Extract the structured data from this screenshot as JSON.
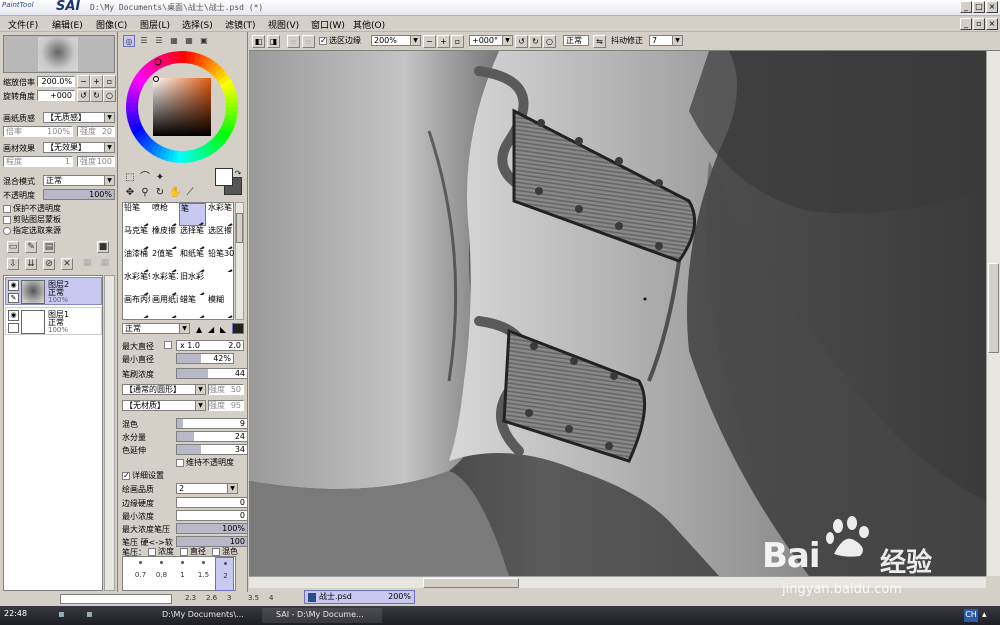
{
  "app": {
    "logo_small": "PaintTool",
    "logo_big": "SAI",
    "title": "D:\\My Documents\\桌面\\战士\\战士.psd (*)"
  },
  "menu": [
    "文件(F)",
    "编辑(E)",
    "图像(C)",
    "图层(L)",
    "选择(S)",
    "滤镜(T)",
    "视图(V)",
    "窗口(W)",
    "其他(O)"
  ],
  "navigator": {
    "zoom_label": "缩放倍率",
    "zoom_value": "200.0%",
    "rotate_label": "旋转角度",
    "rotate_value": "+000"
  },
  "layer_props": {
    "paper_label": "画纸质感",
    "paper_value": "【无质感】",
    "ratio_label": "倍率",
    "ratio_value": "100%",
    "strength_label": "强度",
    "strength_value": "20",
    "effect_label": "画材效果",
    "effect_value": "【无效果】",
    "degree_label": "程度",
    "degree_value": "1",
    "effect_strength_value": "100",
    "blend_label": "混合模式",
    "blend_value": "正常",
    "opacity_label": "不透明度",
    "opacity_value": "100%",
    "opacity_fraction": 1.0,
    "protect_opacity": "保护不透明度",
    "clip_group": "剪贴图层蒙板",
    "select_source": "指定选取来源"
  },
  "layers": [
    {
      "name": "图层2",
      "mode": "正常",
      "opacity": "100%",
      "selected": true
    },
    {
      "name": "图层1",
      "mode": "正常",
      "opacity": "100%",
      "selected": false
    }
  ],
  "brushes": [
    {
      "label": "铅笔"
    },
    {
      "label": "喷枪"
    },
    {
      "label": "笔",
      "selected": true
    },
    {
      "label": "水彩笔"
    },
    {
      "label": "马克笔"
    },
    {
      "label": "橡皮擦"
    },
    {
      "label": "选择笔"
    },
    {
      "label": "选区擦"
    },
    {
      "label": "油漆桶"
    },
    {
      "label": "2值笔"
    },
    {
      "label": "和纸笔"
    },
    {
      "label": "铅笔30"
    },
    {
      "label": "水彩笔9版"
    },
    {
      "label": "水彩笔10版"
    },
    {
      "label": "旧水彩"
    },
    {
      "label": ""
    },
    {
      "label": "画布丙烯"
    },
    {
      "label": "画用纸丙烯"
    },
    {
      "label": "蜡笔"
    },
    {
      "label": "模糊"
    }
  ],
  "brush_settings": {
    "mode": "正常",
    "max_size_label": "最大直径",
    "max_size_mult": "x 1.0",
    "max_size_value": "2.0",
    "min_size_label": "最小直径",
    "min_size_value": "42%",
    "min_size_fraction": 0.42,
    "density_label": "笔刷浓度",
    "density_value": "44",
    "density_fraction": 0.44,
    "shape_value": "【通常的圆形】",
    "shape_strength_label": "强度",
    "shape_strength_value": "50",
    "texture_value": "【无材质】",
    "texture_strength_label": "强度",
    "texture_strength_value": "95",
    "blend_label": "混色",
    "blend_value": "9",
    "blend_fraction": 0.09,
    "water_label": "水分量",
    "water_value": "24",
    "water_fraction": 0.24,
    "stretch_label": "色延伸",
    "stretch_value": "34",
    "stretch_fraction": 0.34,
    "keep_opacity": "维持不透明度",
    "detail_label": "详细设置",
    "quality_label": "绘画品质",
    "quality_value": "2",
    "edge_label": "边缘硬度",
    "edge_value": "0",
    "edge_fraction": 0.0,
    "min_density_label": "最小浓度",
    "min_density_value": "0",
    "min_density_fraction": 0.0,
    "max_pressure_label": "最大浓度笔压",
    "max_pressure_value": "100%",
    "max_pressure_fraction": 1.0,
    "pressure_label": "笔压 硬<->软",
    "pressure_value": "100",
    "pressure_fraction": 1.0,
    "pen_label": "笔压：",
    "pen_density": "浓度",
    "pen_size": "直径",
    "pen_blend": "混色"
  },
  "size_presets": [
    {
      "value": "0.7"
    },
    {
      "value": "0.8"
    },
    {
      "value": "1"
    },
    {
      "value": "1.5"
    },
    {
      "value": "2",
      "selected": true
    }
  ],
  "size_presets_row2": [
    "2.3",
    "2.6",
    "3",
    "3.5",
    "4"
  ],
  "canvas_toolbar": {
    "selection_edge": "选区边缘",
    "zoom": "200%",
    "angle": "+000°",
    "mode": "正常",
    "stabilizer_label": "抖动修正",
    "stabilizer_value": "7"
  },
  "document_tab": {
    "name": "战士.psd",
    "zoom": "200%"
  },
  "taskbar": {
    "clock": "22:48",
    "task1": "D:\\My Documents\\...",
    "task2": "SAI - D:\\My Docume...",
    "ime": "CH"
  },
  "watermark": {
    "brand": "Bai",
    "brand_cn": "经验",
    "url": "jingyan.baidu.com"
  },
  "colors": {
    "selection_blue": "#c8c8f0",
    "panel": "#d4d0c8",
    "taskbar": "#2a2a32"
  }
}
